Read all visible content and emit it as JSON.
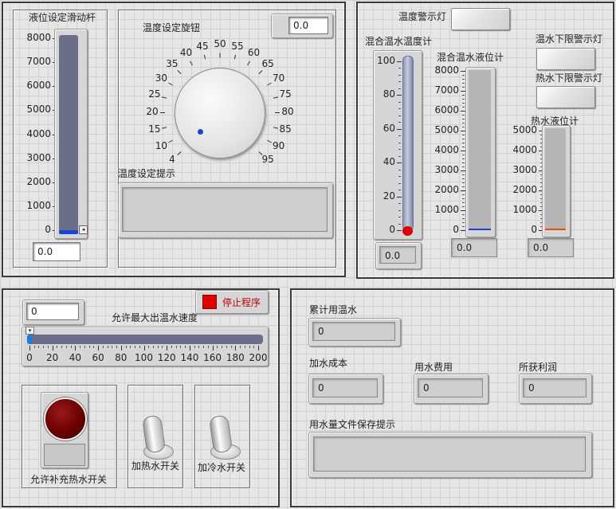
{
  "level_slider": {
    "title": "液位设定滑动杆",
    "ticks": [
      "8000",
      "7000",
      "6000",
      "5000",
      "4000",
      "3000",
      "2000",
      "1000",
      "0"
    ],
    "value_text": "0.0",
    "level_fraction": 0
  },
  "temp_knob": {
    "title": "温度设定旋钮",
    "ticks": [
      "4",
      "10",
      "15",
      "20",
      "25",
      "30",
      "35",
      "40",
      "45",
      "50",
      "55",
      "60",
      "65",
      "70",
      "75",
      "80",
      "85",
      "90",
      "95"
    ],
    "value_text": "0.0",
    "hint_label": "温度设定提示",
    "hint_text": ""
  },
  "mix_panel": {
    "warn_lamp_label": "温度警示灯",
    "thermo_title": "混合温水温度计",
    "thermo_ticks": [
      "100",
      "80",
      "60",
      "40",
      "20",
      "0"
    ],
    "thermo_value": "0.0",
    "mix_level_title": "混合温水液位计",
    "mix_level_ticks": [
      "8000",
      "7000",
      "6000",
      "5000",
      "4000",
      "3000",
      "2000",
      "1000",
      "0"
    ],
    "mix_level_value": "0.0",
    "warm_low_lamp_label": "温水下限警示灯",
    "hot_low_lamp_label": "热水下限警示灯",
    "hot_level_title": "热水液位计",
    "hot_level_ticks": [
      "5000",
      "4000",
      "3000",
      "2000",
      "1000",
      "0"
    ],
    "hot_level_value": "0.0"
  },
  "speed_panel": {
    "stop_button_label": "停止程序",
    "speed_value": "0",
    "speed_title": "允许最大出温水速度",
    "speed_ticks": [
      "0",
      "20",
      "40",
      "60",
      "80",
      "100",
      "120",
      "140",
      "160",
      "180",
      "200"
    ],
    "speed_fraction": 0,
    "hot_refill_label": "允许补充热水开关",
    "add_hot_label": "加热水开关",
    "add_cold_label": "加冷水开关"
  },
  "cost_panel": {
    "total_label": "累计用温水",
    "total_value": "0",
    "add_cost_label": "加水成本",
    "add_cost_value": "0",
    "water_fee_label": "用水费用",
    "water_fee_value": "0",
    "profit_label": "所获利润",
    "profit_value": "0",
    "file_hint_label": "用水量文件保存提示",
    "file_hint_text": ""
  },
  "colors": {
    "slider_fill": "#6b6e88",
    "indicator_blue": "#1a44d8",
    "stop_red": "#e00000",
    "lamp_dark_red": "#6a0000",
    "thermo_red": "#d80000"
  }
}
